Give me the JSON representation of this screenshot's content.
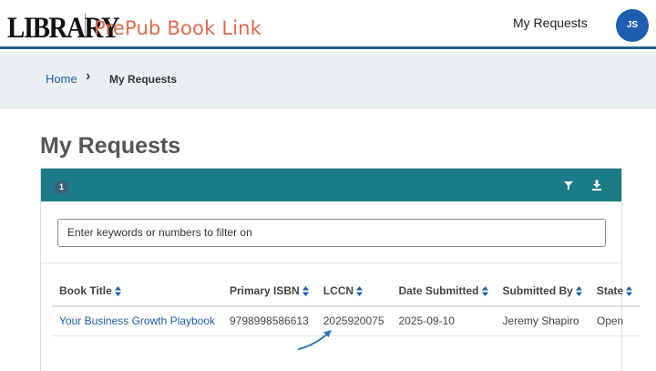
{
  "header": {
    "logo": "LIBRARY",
    "app_title": "PrePub Book Link",
    "nav_my_requests": "My Requests",
    "avatar_initials": "JS"
  },
  "breadcrumb": {
    "home": "Home",
    "current": "My Requests"
  },
  "page_title": "My Requests",
  "panel": {
    "count_badge": "1",
    "filter_icon": "filter-icon",
    "download_icon": "download-icon",
    "search_placeholder": "Enter keywords or numbers to filter on"
  },
  "table": {
    "columns": [
      "Book Title",
      "Primary ISBN",
      "LCCN",
      "Date Submitted",
      "Submitted By",
      "State"
    ],
    "rows": [
      {
        "book_title": "Your Business Growth Playbook",
        "primary_isbn": "9798998586613",
        "lccn": "2025920075",
        "date_submitted": "2025-09-10",
        "submitted_by": "Jeremy Shapiro",
        "state": "Open"
      }
    ]
  },
  "colors": {
    "brand_orange": "#e06a4c",
    "header_teal": "#1b7b86",
    "link_blue": "#1d5fae"
  }
}
